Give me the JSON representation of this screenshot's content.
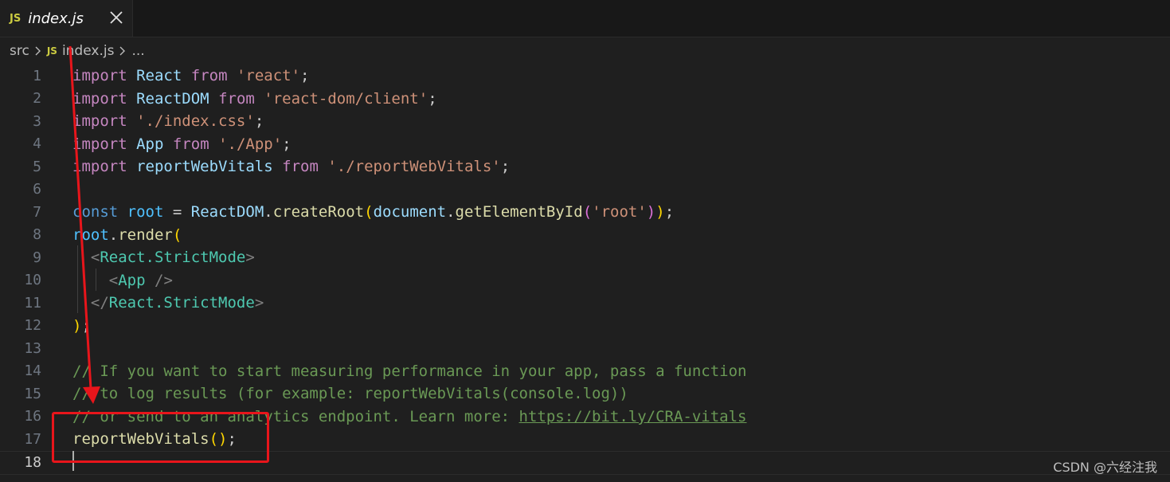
{
  "tab": {
    "badge": "JS",
    "title": "index.js"
  },
  "breadcrumb": {
    "folder": "src",
    "badge": "JS",
    "file": "index.js",
    "more": "..."
  },
  "editor": {
    "lines": [
      {
        "num": "1"
      },
      {
        "num": "2"
      },
      {
        "num": "3"
      },
      {
        "num": "4"
      },
      {
        "num": "5"
      },
      {
        "num": "6"
      },
      {
        "num": "7"
      },
      {
        "num": "8"
      },
      {
        "num": "9"
      },
      {
        "num": "10"
      },
      {
        "num": "11"
      },
      {
        "num": "12"
      },
      {
        "num": "13"
      },
      {
        "num": "14"
      },
      {
        "num": "15"
      },
      {
        "num": "16"
      },
      {
        "num": "17"
      },
      {
        "num": "18"
      }
    ],
    "tokens": {
      "import": "import",
      "from": "from",
      "const": "const",
      "React": "React",
      "ReactDOM": "ReactDOM",
      "App": "App",
      "reportWebVitals": "reportWebVitals",
      "s_react": "'react'",
      "s_react_dom": "'react-dom/client'",
      "s_index_css": "'./index.css'",
      "s_app": "'./App'",
      "s_rwv": "'./reportWebVitals'",
      "s_root": "'root'",
      "root": "root",
      "createRoot": "createRoot",
      "document": "document",
      "getElementById": "getElementById",
      "render": "render",
      "strict_open": "React.StrictMode",
      "strict_close": "React.StrictMode",
      "comment1": "// If you want to start measuring performance in your app, pass a function",
      "comment2": "// to log results (for example: reportWebVitals(console.log))",
      "comment3_a": "// or send to an analytics endpoint. Learn more: ",
      "comment3_link": "https://bit.ly/CRA-vitals",
      "call_rwv": "reportWebVitals"
    },
    "active_line": "18"
  },
  "watermark": "CSDN @六经注我",
  "annotation": {
    "color": "#e8151b"
  }
}
